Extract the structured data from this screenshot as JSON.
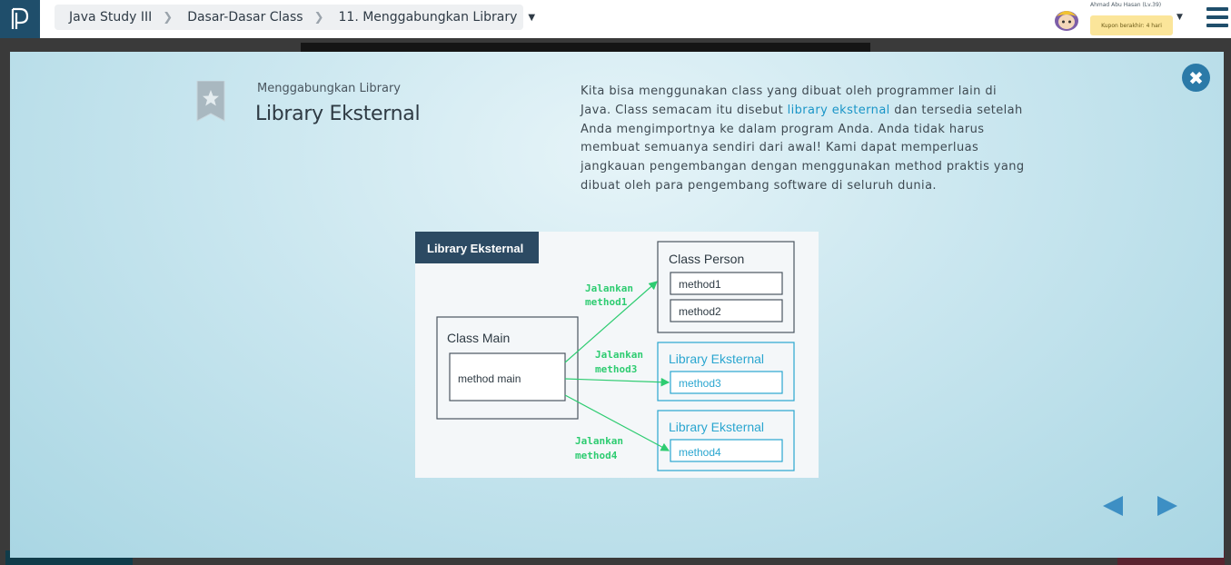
{
  "breadcrumb": {
    "items": [
      "Java Study III",
      "Dasar-Dasar Class",
      "11. Menggabungkan Library"
    ]
  },
  "user": {
    "name": "Ahmad Abu Hasan (Lv.39)",
    "coupon": "Kupon berakhir: 4 hari"
  },
  "slide": {
    "subtitle": "Menggabungkan Library",
    "title": "Library Eksternal",
    "desc_part1": "Kita bisa menggunakan class yang dibuat oleh programmer lain di Java. Class semacam itu disebut ",
    "desc_highlight": "library eksternal",
    "desc_part2": " dan tersedia setelah Anda mengimportnya ke dalam program Anda. Anda tidak harus membuat semuanya sendiri dari awal! Kami dapat memperluas jangkauan pengembangan dengan menggunakan method praktis yang dibuat oleh para pengembang software di seluruh dunia."
  },
  "diagram": {
    "header": "Library Eksternal",
    "class_main": "Class Main",
    "method_main": "method main",
    "class_person": "Class Person",
    "method1": "method1",
    "method2": "method2",
    "lib1_title": "Library Eksternal",
    "method3": "method3",
    "lib2_title": "Library Eksternal",
    "method4": "method4",
    "arrow1_line1": "Jalankan",
    "arrow1_line2": "method1",
    "arrow2_line1": "Jalankan",
    "arrow2_line2": "method3",
    "arrow3_line1": "Jalankan",
    "arrow3_line2": "method4"
  },
  "colors": {
    "brand": "#1f4e6b",
    "accent": "#1a95c7",
    "arrow_green": "#2ecc71"
  }
}
